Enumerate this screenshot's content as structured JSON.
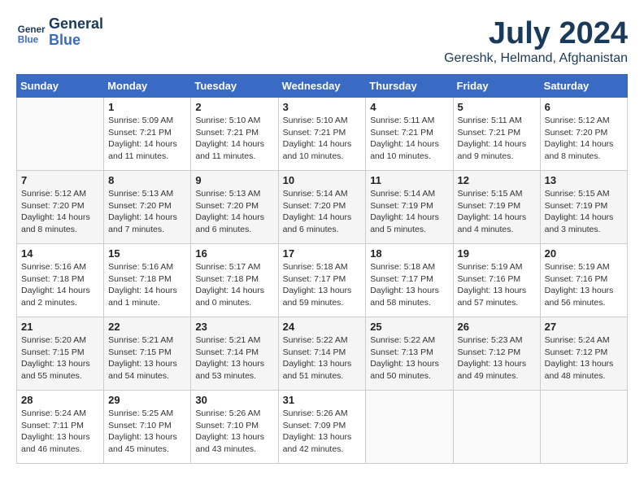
{
  "header": {
    "logo_line1": "General",
    "logo_line2": "Blue",
    "month": "July 2024",
    "location": "Gereshk, Helmand, Afghanistan"
  },
  "days_of_week": [
    "Sunday",
    "Monday",
    "Tuesday",
    "Wednesday",
    "Thursday",
    "Friday",
    "Saturday"
  ],
  "weeks": [
    [
      {
        "day": "",
        "info": ""
      },
      {
        "day": "1",
        "info": "Sunrise: 5:09 AM\nSunset: 7:21 PM\nDaylight: 14 hours\nand 11 minutes."
      },
      {
        "day": "2",
        "info": "Sunrise: 5:10 AM\nSunset: 7:21 PM\nDaylight: 14 hours\nand 11 minutes."
      },
      {
        "day": "3",
        "info": "Sunrise: 5:10 AM\nSunset: 7:21 PM\nDaylight: 14 hours\nand 10 minutes."
      },
      {
        "day": "4",
        "info": "Sunrise: 5:11 AM\nSunset: 7:21 PM\nDaylight: 14 hours\nand 10 minutes."
      },
      {
        "day": "5",
        "info": "Sunrise: 5:11 AM\nSunset: 7:21 PM\nDaylight: 14 hours\nand 9 minutes."
      },
      {
        "day": "6",
        "info": "Sunrise: 5:12 AM\nSunset: 7:20 PM\nDaylight: 14 hours\nand 8 minutes."
      }
    ],
    [
      {
        "day": "7",
        "info": "Sunrise: 5:12 AM\nSunset: 7:20 PM\nDaylight: 14 hours\nand 8 minutes."
      },
      {
        "day": "8",
        "info": "Sunrise: 5:13 AM\nSunset: 7:20 PM\nDaylight: 14 hours\nand 7 minutes."
      },
      {
        "day": "9",
        "info": "Sunrise: 5:13 AM\nSunset: 7:20 PM\nDaylight: 14 hours\nand 6 minutes."
      },
      {
        "day": "10",
        "info": "Sunrise: 5:14 AM\nSunset: 7:20 PM\nDaylight: 14 hours\nand 6 minutes."
      },
      {
        "day": "11",
        "info": "Sunrise: 5:14 AM\nSunset: 7:19 PM\nDaylight: 14 hours\nand 5 minutes."
      },
      {
        "day": "12",
        "info": "Sunrise: 5:15 AM\nSunset: 7:19 PM\nDaylight: 14 hours\nand 4 minutes."
      },
      {
        "day": "13",
        "info": "Sunrise: 5:15 AM\nSunset: 7:19 PM\nDaylight: 14 hours\nand 3 minutes."
      }
    ],
    [
      {
        "day": "14",
        "info": "Sunrise: 5:16 AM\nSunset: 7:18 PM\nDaylight: 14 hours\nand 2 minutes."
      },
      {
        "day": "15",
        "info": "Sunrise: 5:16 AM\nSunset: 7:18 PM\nDaylight: 14 hours\nand 1 minute."
      },
      {
        "day": "16",
        "info": "Sunrise: 5:17 AM\nSunset: 7:18 PM\nDaylight: 14 hours\nand 0 minutes."
      },
      {
        "day": "17",
        "info": "Sunrise: 5:18 AM\nSunset: 7:17 PM\nDaylight: 13 hours\nand 59 minutes."
      },
      {
        "day": "18",
        "info": "Sunrise: 5:18 AM\nSunset: 7:17 PM\nDaylight: 13 hours\nand 58 minutes."
      },
      {
        "day": "19",
        "info": "Sunrise: 5:19 AM\nSunset: 7:16 PM\nDaylight: 13 hours\nand 57 minutes."
      },
      {
        "day": "20",
        "info": "Sunrise: 5:19 AM\nSunset: 7:16 PM\nDaylight: 13 hours\nand 56 minutes."
      }
    ],
    [
      {
        "day": "21",
        "info": "Sunrise: 5:20 AM\nSunset: 7:15 PM\nDaylight: 13 hours\nand 55 minutes."
      },
      {
        "day": "22",
        "info": "Sunrise: 5:21 AM\nSunset: 7:15 PM\nDaylight: 13 hours\nand 54 minutes."
      },
      {
        "day": "23",
        "info": "Sunrise: 5:21 AM\nSunset: 7:14 PM\nDaylight: 13 hours\nand 53 minutes."
      },
      {
        "day": "24",
        "info": "Sunrise: 5:22 AM\nSunset: 7:14 PM\nDaylight: 13 hours\nand 51 minutes."
      },
      {
        "day": "25",
        "info": "Sunrise: 5:22 AM\nSunset: 7:13 PM\nDaylight: 13 hours\nand 50 minutes."
      },
      {
        "day": "26",
        "info": "Sunrise: 5:23 AM\nSunset: 7:12 PM\nDaylight: 13 hours\nand 49 minutes."
      },
      {
        "day": "27",
        "info": "Sunrise: 5:24 AM\nSunset: 7:12 PM\nDaylight: 13 hours\nand 48 minutes."
      }
    ],
    [
      {
        "day": "28",
        "info": "Sunrise: 5:24 AM\nSunset: 7:11 PM\nDaylight: 13 hours\nand 46 minutes."
      },
      {
        "day": "29",
        "info": "Sunrise: 5:25 AM\nSunset: 7:10 PM\nDaylight: 13 hours\nand 45 minutes."
      },
      {
        "day": "30",
        "info": "Sunrise: 5:26 AM\nSunset: 7:10 PM\nDaylight: 13 hours\nand 43 minutes."
      },
      {
        "day": "31",
        "info": "Sunrise: 5:26 AM\nSunset: 7:09 PM\nDaylight: 13 hours\nand 42 minutes."
      },
      {
        "day": "",
        "info": ""
      },
      {
        "day": "",
        "info": ""
      },
      {
        "day": "",
        "info": ""
      }
    ]
  ]
}
